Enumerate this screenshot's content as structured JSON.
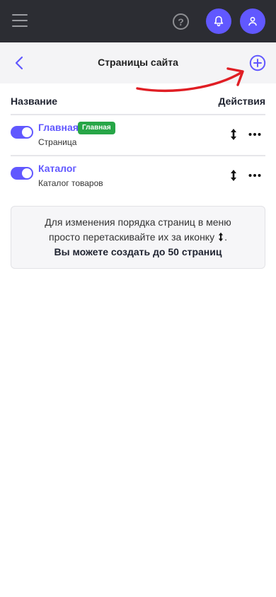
{
  "topbar": {
    "menu_icon": "hamburger-icon",
    "help_label": "?",
    "notifications_icon": "bell-icon",
    "profile_icon": "user-icon"
  },
  "subheader": {
    "back_icon": "chevron-left-icon",
    "title": "Страницы сайта",
    "add_icon": "plus-circle-icon"
  },
  "table": {
    "col_name": "Название",
    "col_actions": "Действия",
    "rows": [
      {
        "title": "Главная",
        "badge": "Главная",
        "subtitle": "Страница",
        "enabled": true
      },
      {
        "title": "Каталог",
        "badge": "",
        "subtitle": "Каталог товаров",
        "enabled": true
      }
    ]
  },
  "info": {
    "line1": "Для изменения порядка страниц в меню",
    "line2": "просто перетаскивайте их за иконку",
    "line2_end": ".",
    "line3": "Вы можете создать до 50 страниц"
  },
  "colors": {
    "accent": "#6158ff",
    "topbar": "#2c2d33",
    "badge": "#27a647",
    "annotation_arrow": "#e01e24"
  }
}
